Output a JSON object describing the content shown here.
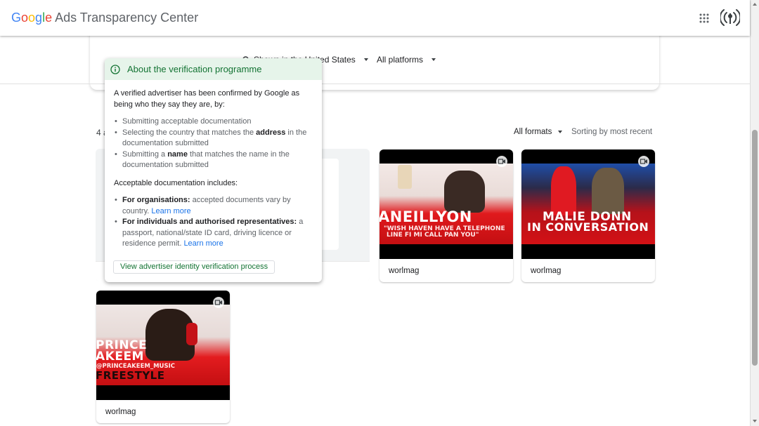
{
  "header": {
    "logo_g": "G",
    "logo_o1": "o",
    "logo_o2": "o",
    "logo_g2": "g",
    "logo_l": "l",
    "logo_e": "e",
    "logo_rest": " Ads Transparency Center",
    "icons": [
      "apps-grid-icon",
      "ad-signal-icon"
    ]
  },
  "filters": {
    "region": "Shown in the United States",
    "platforms": "All platforms"
  },
  "results": {
    "count_fragment": "4 a",
    "formats": "All formats",
    "sorting": "Sorting by most recent"
  },
  "popover": {
    "title": "About the verification programme",
    "intro": "A verified advertiser has been confirmed by Google as being who they say they are, by:",
    "step1": "Submitting acceptable documentation",
    "step2_pre": "Selecting the country that matches the ",
    "step2_bold": "address",
    "step2_post": " in the documentation submitted",
    "step3_pre": "Submitting a ",
    "step3_bold": "name",
    "step3_post": " that matches the name in the documentation submitted",
    "docs_heading": "Acceptable documentation includes:",
    "org_bold": "For organisations:",
    "org_text": " accepted documents vary by country. ",
    "org_link": "Learn more",
    "ind_bold": "For individuals and authorised representatives:",
    "ind_text": " a passport, national/state ID card, driving licence or residence permit. ",
    "ind_link": "Learn more",
    "button": "View advertiser identity verification process"
  },
  "cards": [
    {
      "advertiser": "worlmag",
      "big": "ANEILLYON",
      "sub1": "\"WISH HAVEN HAVE A TELEPHONE",
      "sub2": "LINE FI MI CALL PAN YOU\""
    },
    {
      "advertiser": "worlmag",
      "big1": "MALIE DONN",
      "big2": "IN CONVERSATION"
    },
    {
      "advertiser": "worlmag",
      "big1": "PRINCE",
      "big2": "AKEEM",
      "handle": "@PRINCEAKEEM_MUSIC",
      "big3": "FREESTYLE"
    }
  ],
  "colors": {
    "accent_green": "#137333",
    "popover_header_bg": "#e6f4ea",
    "link_blue": "#1a73e8",
    "thumb_red": "#d90f12"
  }
}
